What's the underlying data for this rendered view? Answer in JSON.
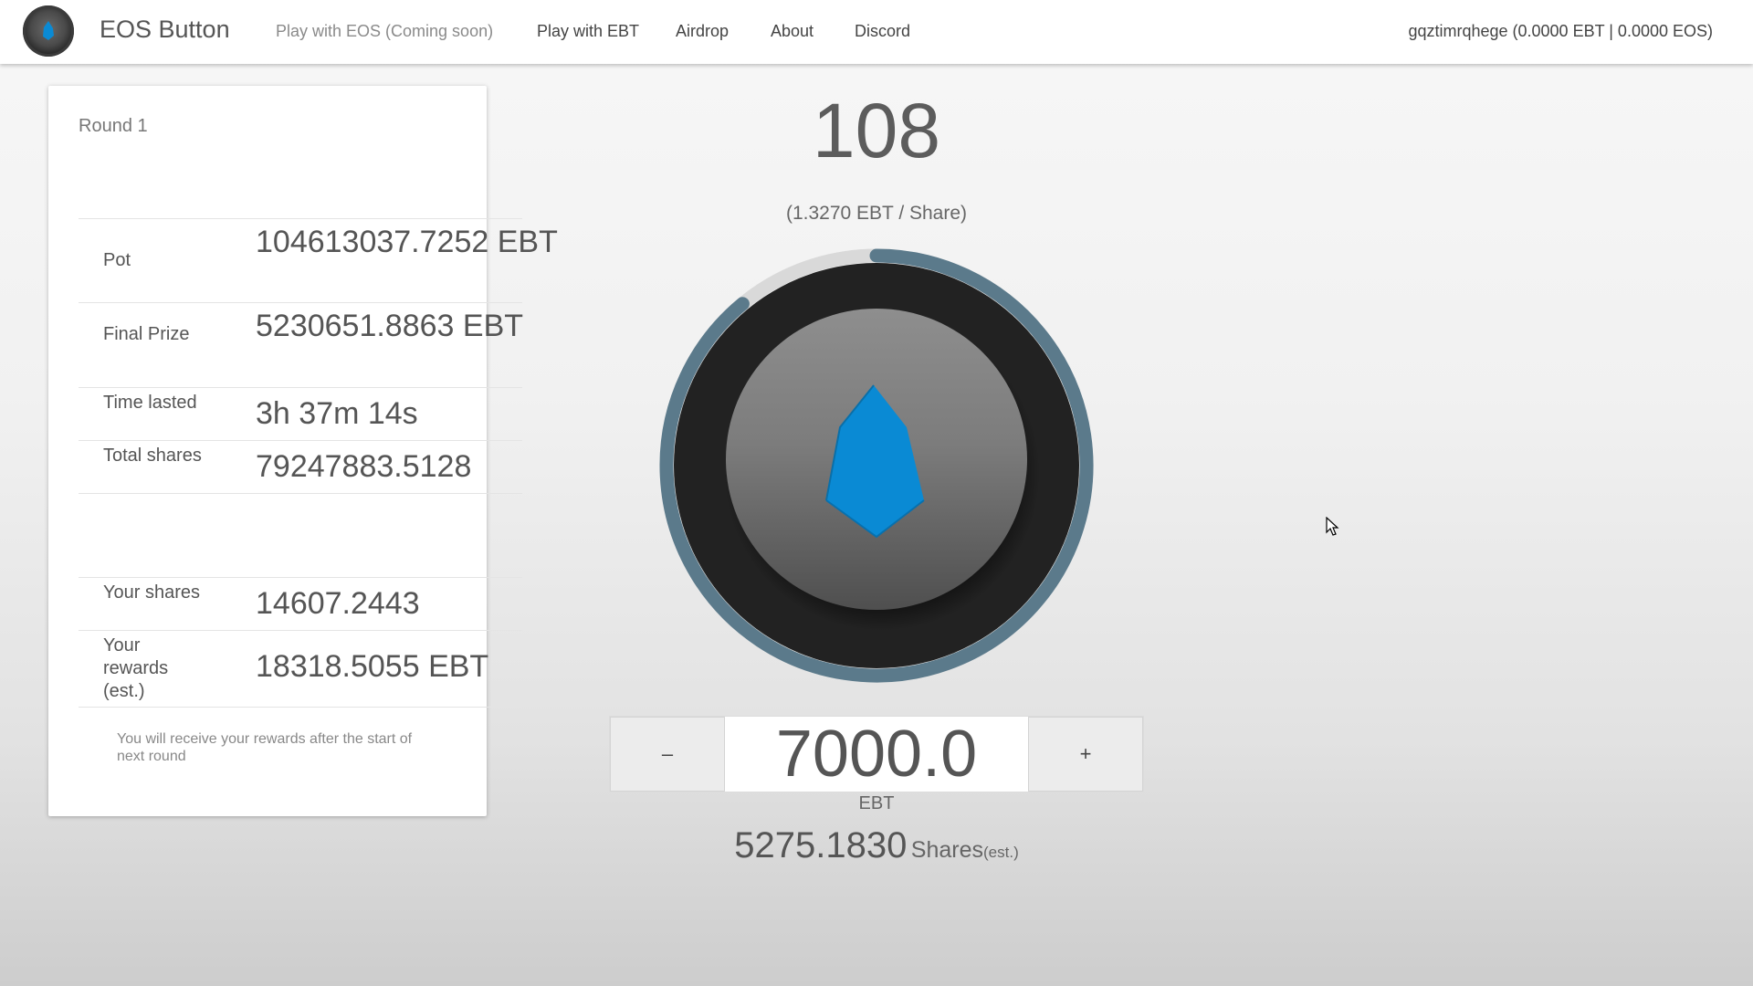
{
  "nav": {
    "brand": "EOS Button",
    "links": [
      {
        "label": "Play with EOS (Coming soon)",
        "disabled": true
      },
      {
        "label": "Play with EBT"
      },
      {
        "label": "Airdrop"
      },
      {
        "label": "About"
      },
      {
        "label": "Discord"
      }
    ],
    "account": "gqztimrqhege (0.0000 EBT | 0.0000 EOS)"
  },
  "round": {
    "title": "Round 1",
    "stats": [
      {
        "label": "Pot",
        "value": "104613037.7252 EBT"
      },
      {
        "label": "Final Prize",
        "value": "5230651.8863 EBT"
      },
      {
        "label": "Time lasted",
        "value": "3h 37m 14s"
      },
      {
        "label": "Total shares",
        "value": "79247883.5128"
      }
    ],
    "personal": [
      {
        "label": "Your shares",
        "value": "14607.2443"
      },
      {
        "label": "Your rewards (est.)",
        "value": "18318.5055 EBT"
      }
    ],
    "note": "You will receive your rewards after the start of next round"
  },
  "game": {
    "counter": "108",
    "rate": "(1.3270 EBT / Share)",
    "ring_progress": 0.89,
    "amount": "7000.0",
    "minus_label": "–",
    "plus_label": "+",
    "unit": "EBT",
    "shares_value": "5275.1830",
    "shares_label": "Shares",
    "shares_suffix": "(est.)"
  },
  "colors": {
    "ring": "#5b7a8b",
    "ring_track": "#d9d9d9",
    "eos_logo": "#0a8ad4"
  }
}
